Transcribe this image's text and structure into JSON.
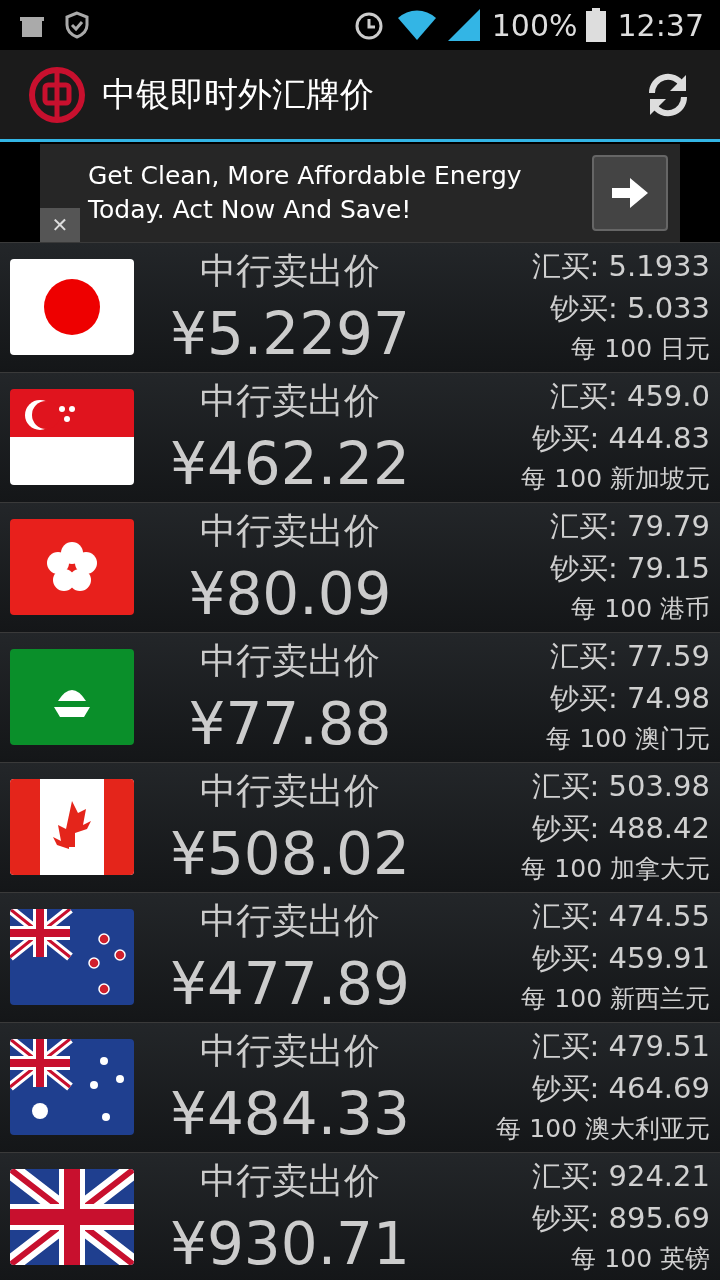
{
  "status_bar": {
    "battery": "100%",
    "time": "12:37"
  },
  "app_bar": {
    "title": "中银即时外汇牌价"
  },
  "ad": {
    "text": "Get Clean, More Affordable Energy Today. Act Now And Save!",
    "close": "✕"
  },
  "rates": [
    {
      "kind": "jp",
      "label": "中行卖出价",
      "price": "¥5.2297",
      "transfer_buy": "汇买: 5.1933",
      "cash_buy": "钞买: 5.033",
      "unit": "每 100 日元"
    },
    {
      "kind": "sg",
      "label": "中行卖出价",
      "price": "¥462.22",
      "transfer_buy": "汇买: 459.0",
      "cash_buy": "钞买: 444.83",
      "unit": "每 100 新加坡元"
    },
    {
      "kind": "hk",
      "label": "中行卖出价",
      "price": "¥80.09",
      "transfer_buy": "汇买: 79.79",
      "cash_buy": "钞买: 79.15",
      "unit": "每 100 港币"
    },
    {
      "kind": "mo",
      "label": "中行卖出价",
      "price": "¥77.88",
      "transfer_buy": "汇买: 77.59",
      "cash_buy": "钞买: 74.98",
      "unit": "每 100 澳门元"
    },
    {
      "kind": "ca",
      "label": "中行卖出价",
      "price": "¥508.02",
      "transfer_buy": "汇买: 503.98",
      "cash_buy": "钞买: 488.42",
      "unit": "每 100 加拿大元"
    },
    {
      "kind": "nz",
      "label": "中行卖出价",
      "price": "¥477.89",
      "transfer_buy": "汇买: 474.55",
      "cash_buy": "钞买: 459.91",
      "unit": "每 100 新西兰元"
    },
    {
      "kind": "au",
      "label": "中行卖出价",
      "price": "¥484.33",
      "transfer_buy": "汇买: 479.51",
      "cash_buy": "钞买: 464.69",
      "unit": "每 100 澳大利亚元"
    },
    {
      "kind": "gb",
      "label": "中行卖出价",
      "price": "¥930.71",
      "transfer_buy": "汇买: 924.21",
      "cash_buy": "钞买: 895.69",
      "unit": "每 100 英镑"
    }
  ]
}
